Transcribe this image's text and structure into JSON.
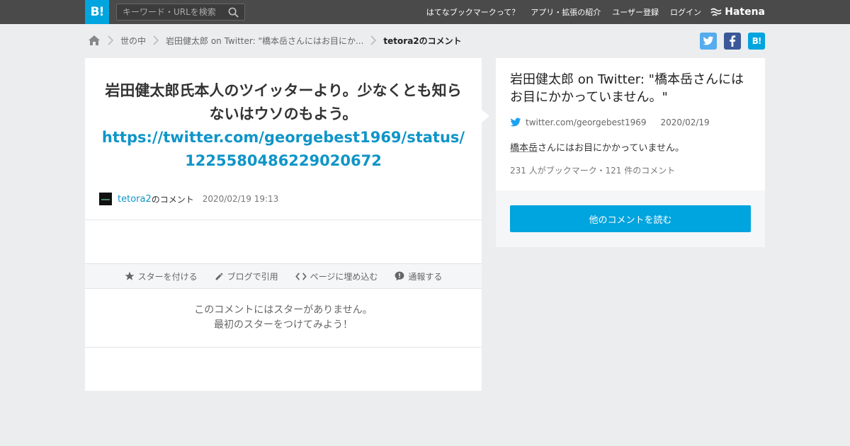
{
  "topbar": {
    "logo_text": "B!",
    "search_placeholder": "キーワード・URLを検索",
    "nav": [
      "はてなブックマークって？",
      "アプリ・拡張の紹介",
      "ユーザー登録",
      "ログイン"
    ],
    "brand": "Hatena"
  },
  "breadcrumb": {
    "items": [
      "世の中",
      "岩田健太郎 on Twitter: \"橋本岳さんにはお目にか...",
      "tetora2のコメント"
    ]
  },
  "share": {
    "twitter": "t",
    "facebook": "f",
    "hatena": "B!"
  },
  "comment": {
    "text": "岩田健太郎氏本人のツイッターより。少なくとも知らないはウソのもよう。",
    "link": "https://twitter.com/georgebest1969/status/1225580486229020672",
    "user": "tetora2",
    "user_suffix": "のコメント",
    "date": "2020/02/19 19:13"
  },
  "actions": [
    "スターを付ける",
    "ブログで引用",
    "ページに埋め込む",
    "通報する"
  ],
  "no_star": {
    "line1": "このコメントにはスターがありません。",
    "line2": "最初のスターをつけてみよう！"
  },
  "entry": {
    "title": "岩田健太郎 on Twitter: \"橋本岳さんにはお目にかかっていません。\"",
    "domain": "twitter.com/georgebest1969",
    "date": "2020/02/19",
    "desc_keyword": "橋本岳",
    "desc_rest": "さんにはお目にかかっていません。",
    "stats": "231 人がブックマーク・121 件のコメント",
    "more_button": "他のコメントを読む"
  },
  "colors": {
    "accent": "#00a4de",
    "link": "#0f95c8",
    "twitter": "#55acee",
    "facebook": "#3b5998",
    "topbar": "#4a4a4a"
  }
}
